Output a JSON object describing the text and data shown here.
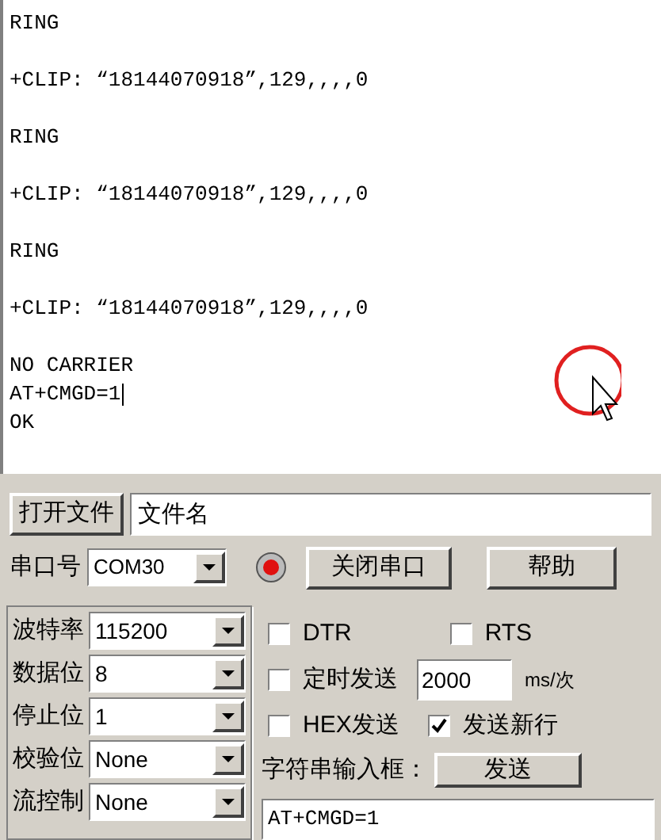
{
  "terminal": {
    "blocks": [
      {
        "lines": [
          {
            "text": "RING",
            "cursor": false
          }
        ]
      },
      {
        "lines": [
          {
            "text": "+CLIP: “18144070918”,129,,,,0",
            "cursor": false
          }
        ]
      },
      {
        "lines": [
          {
            "text": "RING",
            "cursor": false
          }
        ]
      },
      {
        "lines": [
          {
            "text": "+CLIP: “18144070918”,129,,,,0",
            "cursor": false
          }
        ]
      },
      {
        "lines": [
          {
            "text": "RING",
            "cursor": false
          }
        ]
      },
      {
        "lines": [
          {
            "text": "+CLIP: “18144070918”,129,,,,0",
            "cursor": false
          }
        ]
      },
      {
        "lines": [
          {
            "text": "NO CARRIER",
            "cursor": false
          },
          {
            "text": "AT+CMGD=1",
            "cursor": true
          },
          {
            "text": "OK",
            "cursor": false
          }
        ]
      }
    ]
  },
  "file_row": {
    "open_button": "打开文件",
    "filename": "文件名"
  },
  "port_row": {
    "label": "串口号",
    "port": "COM30",
    "led_on": true,
    "close_button": "关闭串口",
    "help_button": "帮助"
  },
  "settings": [
    {
      "label": "波特率",
      "value": "115200"
    },
    {
      "label": "数据位",
      "value": "8"
    },
    {
      "label": "停止位",
      "value": "1"
    },
    {
      "label": "校验位",
      "value": "None"
    },
    {
      "label": "流控制",
      "value": "None"
    }
  ],
  "options": {
    "dtr": {
      "label": "DTR",
      "checked": false
    },
    "rts": {
      "label": "RTS",
      "checked": false
    },
    "timed": {
      "label": "定时发送",
      "checked": false
    },
    "interval": "2000",
    "interval_unit": "ms/次",
    "hex": {
      "label": "HEX发送",
      "checked": false
    },
    "newline": {
      "label": "发送新行",
      "checked": true
    }
  },
  "input_label": "字符串输入框：",
  "send_button": "发送",
  "input_value": "AT+CMGD=1"
}
